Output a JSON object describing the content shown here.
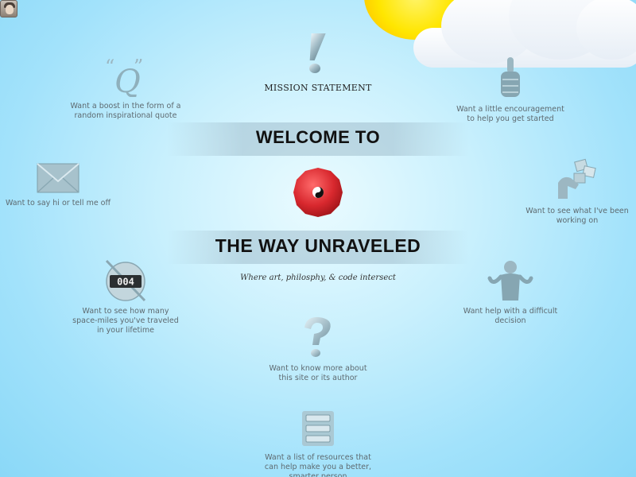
{
  "header": {
    "title_line1": "WELCOME TO",
    "title_line2": "THE WAY UNRAVELED",
    "tagline": "Where art, philosphy, & code intersect"
  },
  "center": {
    "mission_label": "MISSION STATEMENT",
    "logo_icon": "yin-yang-seal-icon"
  },
  "items": [
    {
      "id": "quote",
      "icon": "quote-icon",
      "label": "Want a boost in the form of a random inspirational quote"
    },
    {
      "id": "encouragement",
      "icon": "thumbs-up-icon",
      "label": "Want a little encouragement to help you get started"
    },
    {
      "id": "contact",
      "icon": "envelope-icon",
      "label": "Want to say hi or tell me off"
    },
    {
      "id": "work",
      "icon": "hand-gallery-icon",
      "label": "Want to see what I've been working on"
    },
    {
      "id": "odometer",
      "icon": "odometer-icon",
      "odometer_value": "004",
      "label": "Want to see how many space-miles you've traveled in your lifetime"
    },
    {
      "id": "decision",
      "icon": "shrug-icon",
      "label": "Want help with a difficult decision"
    },
    {
      "id": "about",
      "icon": "question-mark-icon",
      "label": "Want to know more about this site or its author"
    },
    {
      "id": "resources",
      "icon": "list-icon",
      "label": "Want a list of resources that can help make you a better, smarter person"
    }
  ],
  "colors": {
    "sky": "#a2e2fb",
    "sun": "#ffe600",
    "seal": "#d8282e",
    "icon_steel": "#8fb0bc"
  }
}
